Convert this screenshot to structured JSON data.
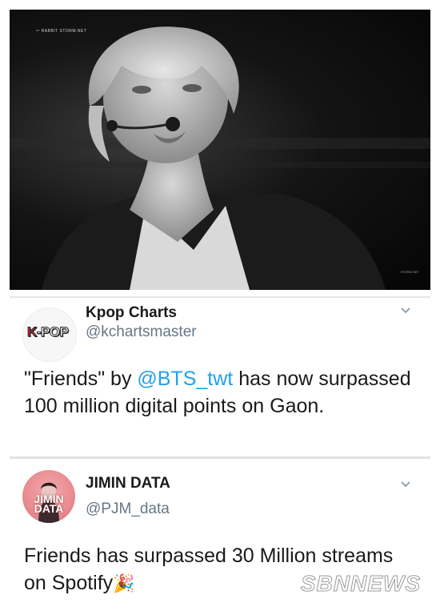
{
  "photo": {
    "alt": "Performer with headset microphone on stage",
    "watermark_small": "ᵒᵒ RABBIT  STORM.NET",
    "watermark_corner": "STORM.NET"
  },
  "tweet1": {
    "avatar_text_k": "K",
    "avatar_text_rest": "-POP",
    "name": "Kpop Charts",
    "handle": "@kchartsmaster",
    "text_before": "\"Friends\" by ",
    "mention": "@BTS_twt",
    "text_after": " has now surpassed 100 million digital points on Gaon."
  },
  "tweet2": {
    "avatar_line1": "JIMIN",
    "avatar_line2": "DATA",
    "name": "JIMIN DATA",
    "handle": "@PJM_data",
    "text": "Friends has surpassed 30 Million streams on Spotify",
    "emoji": "🎉"
  },
  "watermark": "SBNNEWS",
  "icons": {
    "chevron": "chevron-down-icon",
    "mic": "headset-mic-icon"
  }
}
